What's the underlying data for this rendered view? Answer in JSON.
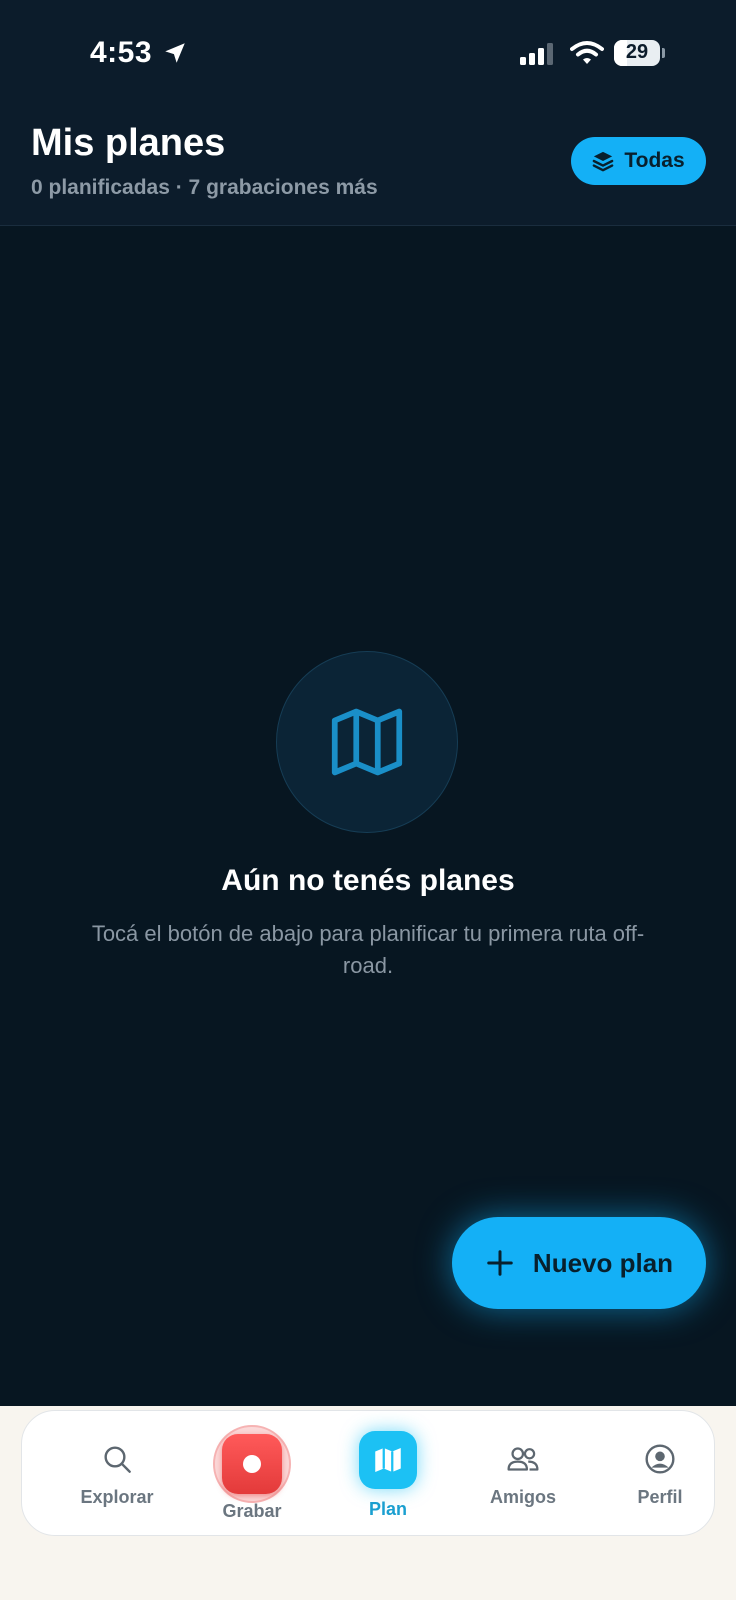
{
  "status_bar": {
    "time": "4:53",
    "battery_level": "29",
    "battery_fraction": 0.29,
    "icons": [
      "location-arrow-icon",
      "cellular-signal-icon",
      "wifi-icon",
      "battery-icon"
    ]
  },
  "header": {
    "title": "Mis planes",
    "subtitle": "0 planificadas · 7 grabaciones más",
    "filter_button": {
      "label": "Todas",
      "icon": "layers-icon"
    }
  },
  "empty_state": {
    "icon": "map-icon",
    "title": "Aún no tenés planes",
    "text": "Tocá el botón de abajo para planificar tu primera ruta off-road."
  },
  "fab": {
    "label": "Nuevo plan",
    "icon": "plus-icon"
  },
  "tabbar": {
    "items": [
      {
        "label": "Explorar",
        "icon": "search-icon",
        "active": false
      },
      {
        "label": "Grabar",
        "icon": "record-icon",
        "active": false
      },
      {
        "label": "Plan",
        "icon": "map-icon",
        "active": true
      },
      {
        "label": "Amigos",
        "icon": "friends-icon",
        "active": false
      },
      {
        "label": "Perfil",
        "icon": "profile-icon",
        "active": false
      }
    ]
  },
  "colors": {
    "background": "#071621",
    "header_bg": "#0c1c2b",
    "accent": "#14b0f6",
    "record_red": "#e84545",
    "plan_active": "#1a9fd0"
  }
}
